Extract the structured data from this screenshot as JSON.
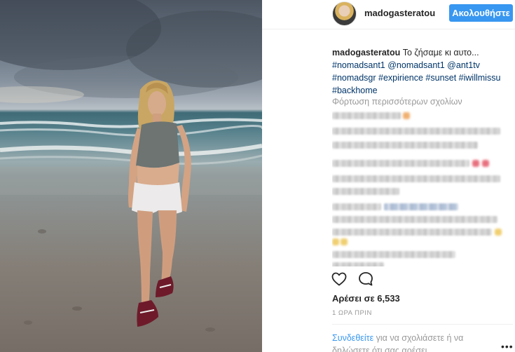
{
  "post": {
    "username": "madogasteratou",
    "follow_label": "Ακολουθήστε",
    "caption": {
      "author": "madogasteratou",
      "text": "Το ζήσαμε κι αυτο...",
      "tags_line1": "#nomadsant1 @nomadsant1 @ant1tv",
      "tags_line2": "#nomadsgr #expirience #sunset #iwillmissu",
      "tags_line3": "#backhome"
    },
    "load_more_label": "Φόρτωση περισσότερων σχολίων",
    "likes_label": "Αρέσει σε 6,533",
    "timestamp": "1 ΩΡΑ ΠΡΙΝ",
    "login_prompt": {
      "link": "Συνδεθείτε",
      "rest": " για να σχολιάσετε ή να δηλώσετε ότι σας αρέσει."
    },
    "more_label": "•••"
  },
  "icons": {
    "heart": "heart-outline-icon",
    "comment": "speech-bubble-icon",
    "more": "ellipsis-icon"
  },
  "colors": {
    "follow_button": "#3897f0",
    "hashtag": "#003569",
    "muted": "#999999",
    "link": "#3897f0"
  }
}
